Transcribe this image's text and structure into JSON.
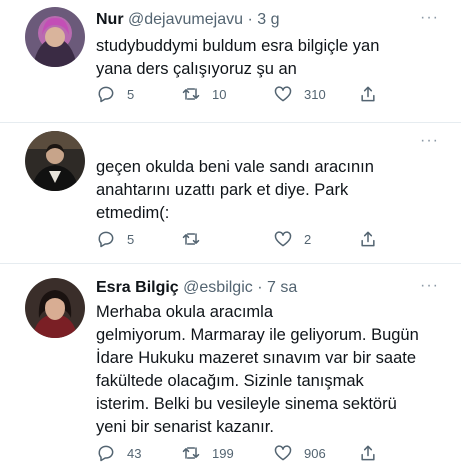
{
  "tweets": [
    {
      "name": "Nur",
      "handle": "@dejavumejavu",
      "separator": "·",
      "time": "3 g",
      "more": "···",
      "text": "studybuddymi buldum esra bilgiçle yan\nyana ders çalışıyoruz şu an",
      "replies": "5",
      "retweets": "10",
      "likes": "310"
    },
    {
      "name": "",
      "handle": "",
      "time": "",
      "more": "···",
      "text": "geçen okulda beni vale sandı aracının\nanahtarını uzattı park et diye. Park\netmedim(:",
      "replies": "5",
      "retweets": "",
      "likes": "2"
    },
    {
      "name": "Esra Bilgiç",
      "handle": "@esbilgic",
      "separator": "·",
      "time": "7 sa",
      "more": "···",
      "text": "Merhaba              okula aracımla\ngelmiyorum. Marmaray ile geliyorum. Bugün\nİdare Hukuku mazeret sınavım var bir saate\nfakültede olacağım. Sizinle tanışmak\nisterim. Belki bu vesileyle sinema sektörü\nyeni bir senarist kazanır.",
      "replies": "43",
      "retweets": "199",
      "likes": "906"
    }
  ],
  "icons": {
    "reply": "reply-icon",
    "retweet": "retweet-icon",
    "like": "heart-icon",
    "share": "share-icon",
    "more": "more-icon"
  },
  "colors": {
    "text": "#0f1419",
    "secondary": "#536471",
    "divider": "#e6ecf0"
  }
}
